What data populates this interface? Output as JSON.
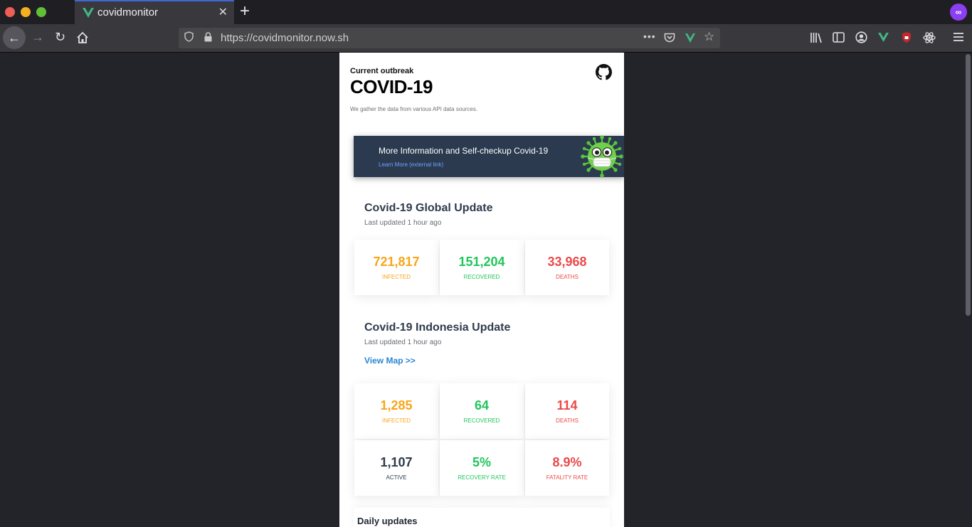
{
  "browser": {
    "tab_title": "covidmonitor",
    "url": "https://covidmonitor.now.sh",
    "new_tab_glyph": "+",
    "close_tab_glyph": "✕",
    "colors": {
      "tab_accent": "#3f67d8",
      "vue_green": "#41b883",
      "private_mask": "#8a3ff0"
    }
  },
  "header": {
    "eyebrow": "Current outbreak",
    "title": "COVID-19",
    "subtitle": "We gather the data from various API data sources."
  },
  "banner": {
    "title": "More Information and Self-checkup Covid-19",
    "link": "Learn More (external link)"
  },
  "global": {
    "title": "Covid-19 Global Update",
    "updated": "Last updated 1 hour ago",
    "stats": [
      {
        "value": "721,817",
        "label": "INFECTED"
      },
      {
        "value": "151,204",
        "label": "RECOVERED"
      },
      {
        "value": "33,968",
        "label": "DEATHS"
      }
    ]
  },
  "indonesia": {
    "title": "Covid-19 Indonesia Update",
    "updated": "Last updated 1 hour ago",
    "view_map": "View Map >>",
    "stats": [
      {
        "value": "1,285",
        "label": "INFECTED"
      },
      {
        "value": "64",
        "label": "RECOVERED"
      },
      {
        "value": "114",
        "label": "DEATHS"
      },
      {
        "value": "1,107",
        "label": "ACTIVE"
      },
      {
        "value": "5%",
        "label": "RECOVERY RATE"
      },
      {
        "value": "8.9%",
        "label": "FATALITY RATE"
      }
    ]
  },
  "daily": {
    "title": "Daily updates"
  },
  "colors": {
    "infected": "#f9a51a",
    "recovered": "#1fc65b",
    "deaths": "#ec4949",
    "neutral": "#2f3b4c",
    "banner_bg": "#2b3a4f",
    "link": "#2b86d6"
  }
}
